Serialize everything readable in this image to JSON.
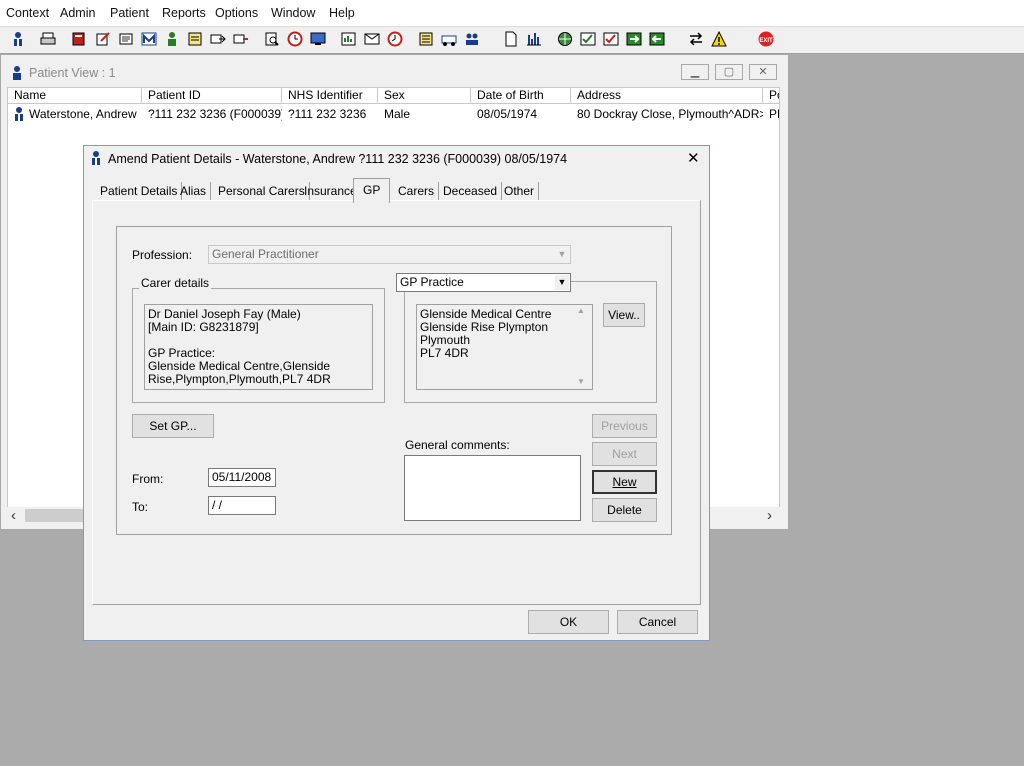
{
  "menu": [
    "Context",
    "Admin",
    "Patient",
    "Reports",
    "Options",
    "Window",
    "Help"
  ],
  "patient_view": {
    "title": "Patient View : 1",
    "columns": [
      "Name",
      "Patient ID",
      "NHS Identifier",
      "Sex",
      "Date of Birth",
      "Address",
      "Po"
    ],
    "rows": [
      [
        "Waterstone, Andrew",
        "?111 232 3236 (F000039)",
        "?111 232 3236",
        "Male",
        "08/05/1974",
        "80 Dockray Close, Plymouth^ADR>>",
        "PL"
      ]
    ],
    "scroll_left": "‹",
    "scroll_right": "›"
  },
  "dialog": {
    "title": "Amend Patient Details - Waterstone, Andrew ?111 232 3236 (F000039) 08/05/1974",
    "close": "✕",
    "tabs": [
      "Patient Details",
      "Alias",
      "Personal Carers",
      "Insurance",
      "GP",
      "Carers",
      "Deceased",
      "Other"
    ],
    "active_tab": "GP",
    "profession_label": "Profession:",
    "profession_value": "General Practitioner",
    "carer_details_label": "Carer details",
    "carer_details_text": "Dr Daniel Joseph Fay (Male)\n[Main ID: G8231879]\n\nGP Practice:\nGlenside Medical Centre,Glenside\nRise,Plympton,Plymouth,PL7 4DR",
    "practice_type_value": "GP Practice",
    "practice_address_text": "Glenside Medical Centre\nGlenside Rise Plympton\nPlymouth\nPL7 4DR",
    "view_button": "View..",
    "set_gp_button": "Set GP...",
    "from_label": "From:",
    "from_value": "05/11/2008",
    "to_label": "To:",
    "to_value": " /  /",
    "general_comments_label": "General comments:",
    "general_comments_value": "",
    "previous_button": "Previous",
    "next_button": "Next",
    "new_button": "New",
    "delete_button": "Delete",
    "ok_button": "OK",
    "cancel_button": "Cancel"
  },
  "colors": {
    "desktop": "#ababab",
    "window_face": "#f0f0f0",
    "dialog_border": "#7a9cc6",
    "exit_red": "#e02020",
    "warning_yellow": "#f5d800"
  }
}
